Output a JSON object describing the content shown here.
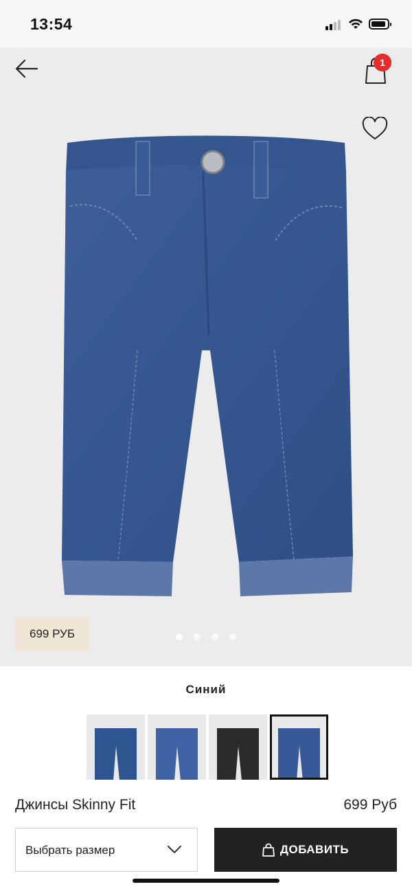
{
  "status_bar": {
    "time": "13:54",
    "icons": [
      "cellular-signal-icon",
      "wifi-icon",
      "battery-icon"
    ]
  },
  "header": {
    "back_icon": "arrow-left-icon",
    "bag_icon": "shopping-bag-icon",
    "bag_count": "1",
    "favorite_icon": "heart-outline-icon"
  },
  "hero": {
    "price_tag": "699 РУБ",
    "carousel": {
      "count": 4,
      "active_index": 0
    }
  },
  "color": {
    "name": "Синий",
    "options": [
      {
        "name": "thumb-denim-dark",
        "color": "#2f5591",
        "selected": false
      },
      {
        "name": "thumb-denim-light",
        "color": "#3e62a4",
        "selected": false
      },
      {
        "name": "thumb-black",
        "color": "#2a2a2a",
        "selected": false
      },
      {
        "name": "thumb-denim-mid",
        "color": "#37599a",
        "selected": true
      }
    ]
  },
  "product": {
    "name": "Джинсы Skinny Fit",
    "price": "699 Руб"
  },
  "actions": {
    "size_placeholder": "Выбрать размер",
    "add_label": "ДОБАВИТЬ"
  },
  "colors": {
    "badge": "#e42c2c",
    "price_tag_bg": "#efe6d5",
    "button_bg": "#222222",
    "denim": "#3a5b93"
  }
}
